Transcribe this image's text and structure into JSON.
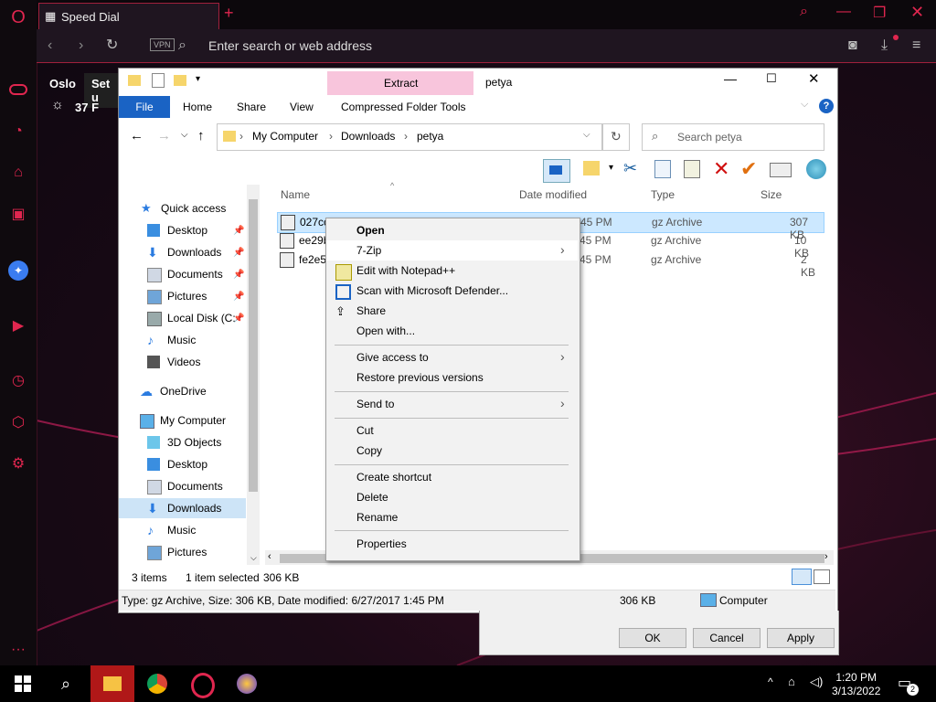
{
  "browser": {
    "tab_title": "Speed Dial",
    "address_placeholder": "Enter search or web address",
    "vpn_label": "VPN",
    "accent": "#e0264f"
  },
  "weather": {
    "city": "Oslo",
    "temp": "37 F",
    "setup_label": "Set u"
  },
  "explorer": {
    "qat_title": "petya",
    "extract_tab": "Extract",
    "tools_tab": "Compressed Folder Tools",
    "ribbon_tabs": [
      "File",
      "Home",
      "Share",
      "View"
    ],
    "breadcrumb": [
      "My Computer",
      "Downloads",
      "petya"
    ],
    "search_placeholder": "Search petya",
    "columns": [
      "Name",
      "Date modified",
      "Type",
      "Size"
    ],
    "nav": {
      "quick_access": "Quick access",
      "qa_items": [
        "Desktop",
        "Downloads",
        "Documents",
        "Pictures",
        "Local Disk (C:",
        "Music",
        "Videos"
      ],
      "onedrive": "OneDrive",
      "my_computer": "My Computer",
      "mc_items": [
        "3D Objects",
        "Desktop",
        "Documents",
        "Downloads",
        "Music",
        "Pictures"
      ]
    },
    "files": [
      {
        "name": "027cc",
        "date": "45 PM",
        "type": "gz Archive",
        "size": "307 KB"
      },
      {
        "name": "ee29b",
        "date": "45 PM",
        "type": "gz Archive",
        "size": "10 KB"
      },
      {
        "name": "fe2e5",
        "date": "45 PM",
        "type": "gz Archive",
        "size": "2 KB"
      }
    ],
    "status": {
      "count": "3 items",
      "selected": "1 item selected",
      "selected_size": "306 KB"
    },
    "details": {
      "text": "Type: gz Archive, Size: 306 KB, Date modified: 6/27/2017 1:45 PM",
      "size": "306 KB",
      "location": "Computer"
    }
  },
  "dialog": {
    "ok": "OK",
    "cancel": "Cancel",
    "apply": "Apply"
  },
  "context_menu": {
    "open": "Open",
    "zip": "7-Zip",
    "notepad": "Edit with Notepad++",
    "defender": "Scan with Microsoft Defender...",
    "share": "Share",
    "open_with": "Open with...",
    "give_access": "Give access to",
    "restore": "Restore previous versions",
    "send_to": "Send to",
    "cut": "Cut",
    "copy": "Copy",
    "create_shortcut": "Create shortcut",
    "delete": "Delete",
    "rename": "Rename",
    "properties": "Properties"
  },
  "taskbar": {
    "time": "1:20 PM",
    "date": "3/13/2022",
    "notification_count": "2"
  }
}
